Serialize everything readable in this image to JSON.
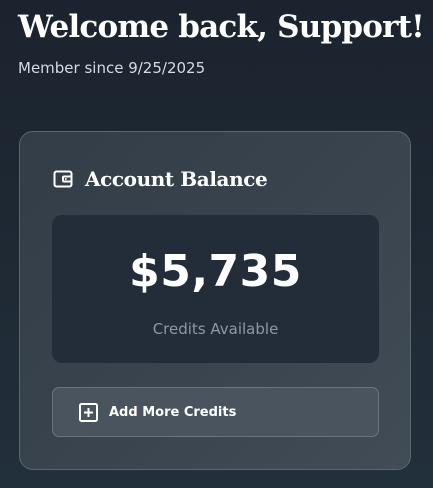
{
  "header": {
    "title": "Welcome back, Support!",
    "member_since": "Member since 9/25/2025"
  },
  "balance_card": {
    "title": "Account Balance",
    "title_icon": "wallet-icon",
    "amount": "$5,735",
    "caption": "Credits Available",
    "add_button_label": "Add More Credits",
    "add_button_icon": "plus-square-icon"
  },
  "colors": {
    "background": "#1f2a35",
    "card": "#3a444e",
    "balance_box": "#222d39",
    "button": "#4a545e",
    "muted_text": "#8f98a2"
  }
}
